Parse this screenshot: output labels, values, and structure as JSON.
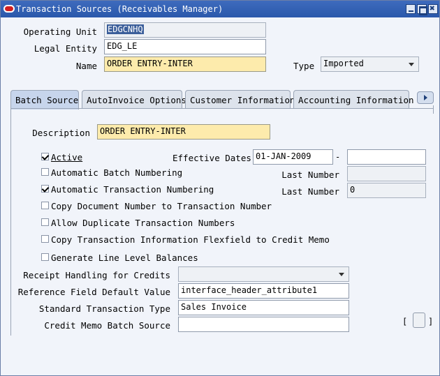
{
  "window": {
    "title": "Transaction Sources (Receivables Manager)"
  },
  "header": {
    "operating_unit": {
      "label": "Operating Unit",
      "value": "EDGCNHQ"
    },
    "legal_entity": {
      "label": "Legal Entity",
      "value": "EDG_LE"
    },
    "name": {
      "label": "Name",
      "value": "ORDER ENTRY-INTER"
    },
    "type": {
      "label": "Type",
      "value": "Imported"
    }
  },
  "tabs": [
    {
      "label": "Batch Source"
    },
    {
      "label": "AutoInvoice Options"
    },
    {
      "label": "Customer Information"
    },
    {
      "label": "Accounting Information"
    }
  ],
  "batch_source": {
    "description": {
      "label": "Description",
      "value": "ORDER ENTRY-INTER"
    },
    "active": {
      "label": "Active",
      "checked": true
    },
    "effective_dates": {
      "label": "Effective Dates",
      "from": "01-JAN-2009",
      "separator": "-",
      "to": ""
    },
    "auto_batch_numbering": {
      "label": "Automatic Batch Numbering",
      "checked": false
    },
    "last_number_batch": {
      "label": "Last Number",
      "value": ""
    },
    "auto_trx_numbering": {
      "label": "Automatic Transaction Numbering",
      "checked": true
    },
    "last_number_trx": {
      "label": "Last Number",
      "value": "0"
    },
    "copy_doc_number": {
      "label": "Copy Document Number to Transaction Number",
      "checked": false
    },
    "allow_duplicate": {
      "label": "Allow Duplicate Transaction Numbers",
      "checked": false
    },
    "copy_flexfield": {
      "label": "Copy Transaction Information Flexfield to Credit Memo",
      "checked": false
    },
    "line_level_balances": {
      "label": "Generate Line Level Balances",
      "checked": false
    },
    "receipt_handling": {
      "label": "Receipt Handling for Credits",
      "value": ""
    },
    "reference_field": {
      "label": "Reference Field Default Value",
      "value": "interface_header_attribute1"
    },
    "standard_trx_type": {
      "label": "Standard Transaction Type",
      "value": "Sales Invoice"
    },
    "credit_memo_batch_source": {
      "label": "Credit Memo Batch Source",
      "value": ""
    },
    "dff": {
      "open": "[",
      "close": "]"
    }
  },
  "colors": {
    "titlebar": "#2a58ab",
    "required_field": "#fdebac",
    "active_tab": "#c7d5ec"
  }
}
